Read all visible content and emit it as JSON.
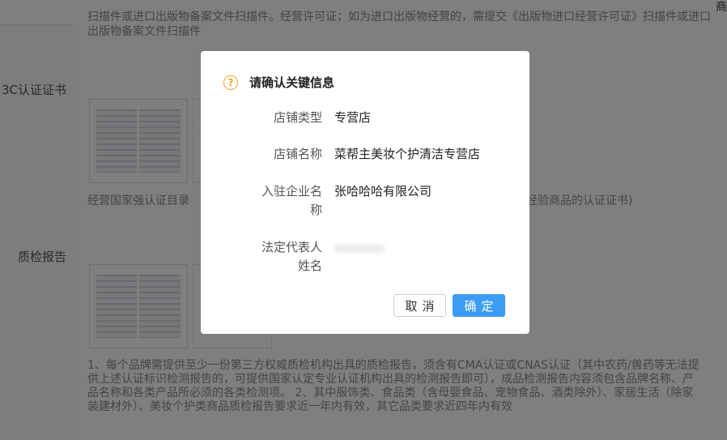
{
  "topbar": {
    "right_text": "商"
  },
  "background": {
    "import_note": "扫描件或进口出版物备案文件扫描件。经营许可证；如为进口出版物经营的，需提交《出版物进口经营许可证》扫描件或进口出版物备案文件扫描件",
    "sections": [
      {
        "label": "3C认证证书",
        "note_left": "经营国家强认证目录",
        "note_right": "经验商品的认证证书)"
      },
      {
        "label": "质检报告"
      }
    ],
    "qc_note": "1、每个品牌需提供至少一份第三方权威质检机构出具的质检报告，须含有CMA认证或CNAS认证（其中农药/兽药等无法提供上述认证标识检测报告的，可提供国家认定专业认证机构出具的检测报告即可），成品检测报告内容须包含品牌名称、产品名称和各类产品所必须的各类检测项。 2、其中服饰类、食品类（含母婴食品、宠物食品、酒类除外）、家居生活（除家装建材外）、美妆个护类商品质检报告要求近一年内有效，其它品类要求近四年内有效"
  },
  "modal": {
    "icon": "question-icon",
    "icon_glyph": "?",
    "title": "请确认关键信息",
    "rows": [
      {
        "label": "店铺类型",
        "value": "专营店"
      },
      {
        "label": "店铺名称",
        "value": "菜帮主美妆个护清洁专营店"
      },
      {
        "label_line1": "入驻企业名",
        "label_line2": "称",
        "value": "张哈哈哈有限公司"
      },
      {
        "label_line1": "法定代表人",
        "label_line2": "姓名",
        "value": ""
      }
    ],
    "cancel_label": "取消",
    "confirm_label": "确定"
  },
  "colors": {
    "accent": "#3c9cf5",
    "warning": "#f5a623",
    "overlay": "rgba(0,0,0,0.5)"
  }
}
